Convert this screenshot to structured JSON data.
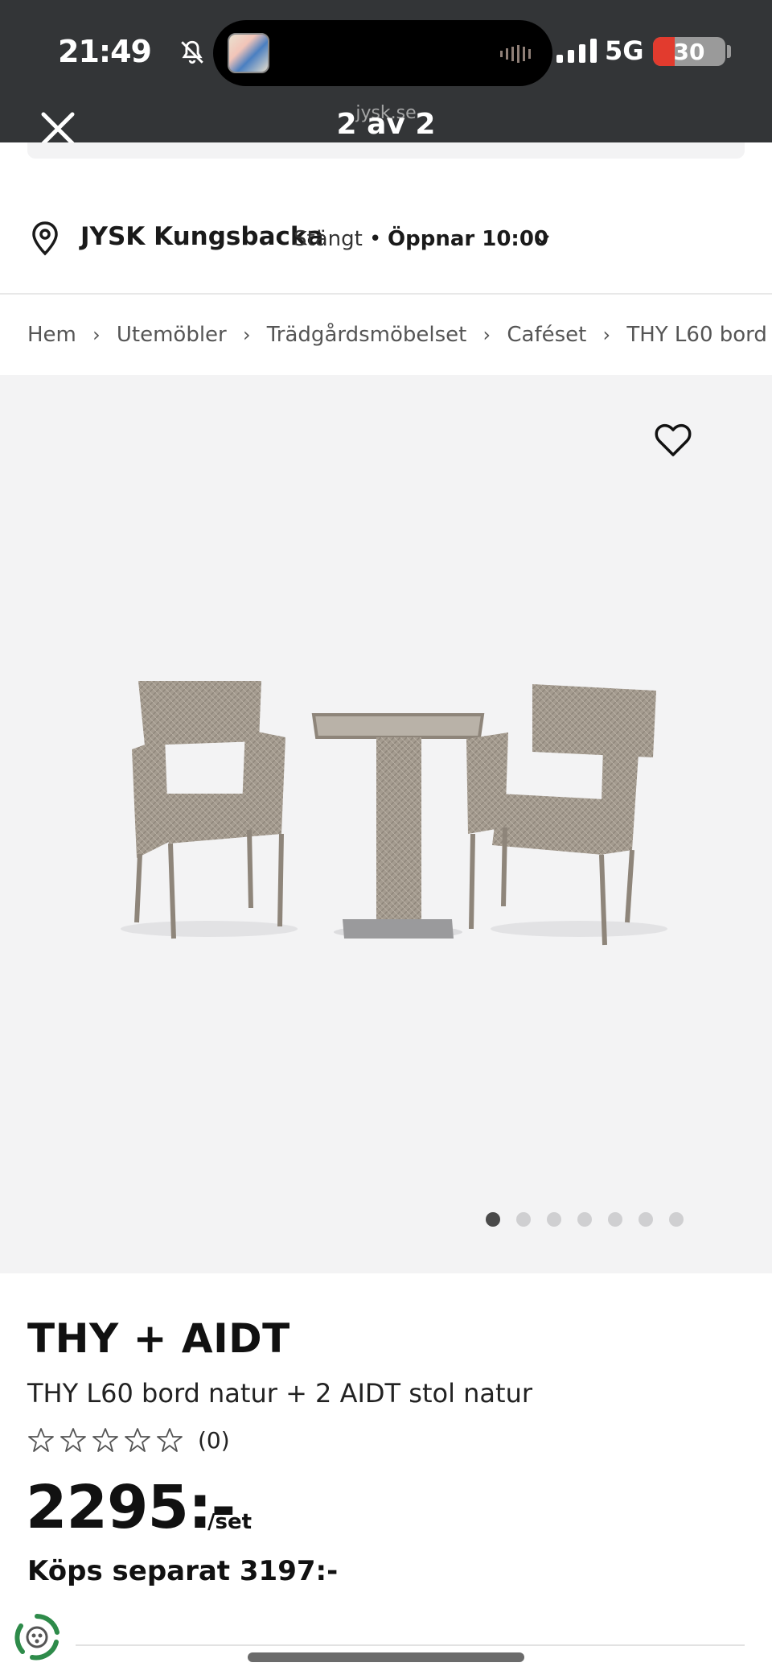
{
  "status_bar": {
    "time": "21:49",
    "network": "5G",
    "battery": "30",
    "battery_level": 0.3
  },
  "viewer": {
    "site": "jysk.se",
    "counter": "2 av 2"
  },
  "store": {
    "name": "JYSK Kungsbacka",
    "status": "Stängt",
    "separator": "•",
    "opening": "Öppnar 10:00"
  },
  "breadcrumb": [
    "Hem",
    "Utemöbler",
    "Trädgårdsmöbelset",
    "Caféset",
    "THY L60 bord"
  ],
  "breadcrumb_separator": "›",
  "gallery": {
    "image_count": 7,
    "active_index": 0,
    "colors": {
      "background": "#f3f3f4",
      "wicker": "#a49b8f",
      "active_dot": "#4a4a4a",
      "inactive_dot": "#cfcfd1"
    }
  },
  "product": {
    "title": "THY + AIDT",
    "subtitle": "THY L60 bord natur + 2 AIDT stol natur",
    "rating_stars": 0,
    "rating_count": "(0)",
    "price": "2295:-",
    "price_unit": "/set",
    "separate_price": "Köps separat 3197:-"
  },
  "icons": [
    "bell-slash-icon",
    "close-icon",
    "location-pin-icon",
    "chevron-down-icon",
    "heart-icon",
    "star-icon",
    "eco-recycle-icon"
  ]
}
